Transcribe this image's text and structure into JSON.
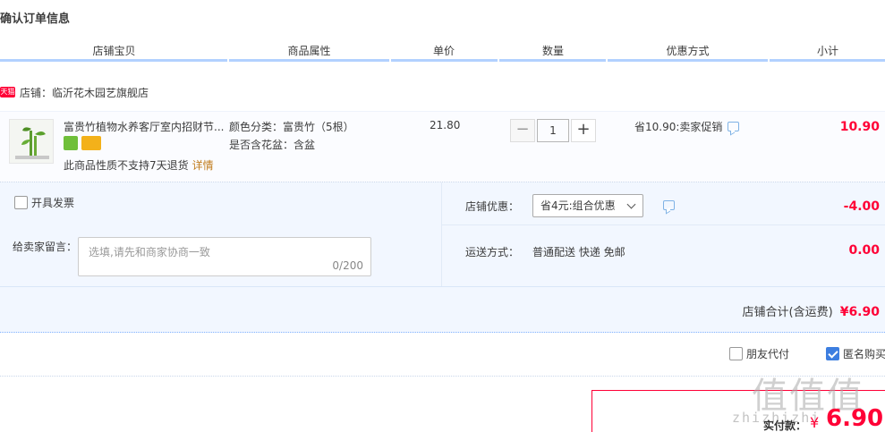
{
  "page": {
    "title": "确认订单信息"
  },
  "columns": [
    "店铺宝贝",
    "商品属性",
    "单价",
    "数量",
    "优惠方式",
    "小计"
  ],
  "shop": {
    "badge": "天猫",
    "label": "店铺：临沂花木园艺旗舰店"
  },
  "item": {
    "title": "富贵竹植物水养客厅室内招财节...",
    "attr_color": "颜色分类：富贵竹（5根）",
    "attr_pot": "是否含花盆：含盆",
    "no_return": "此商品性质不支持7天退货",
    "detail_link": "详情",
    "unit_price": "21.80",
    "qty_minus": "−",
    "qty_plus": "+",
    "quantity": "1",
    "promo": "省10.90:卖家促销",
    "subtotal": "10.90"
  },
  "invoice": {
    "label": "开具发票"
  },
  "message": {
    "label": "给卖家留言：",
    "placeholder": "选填,请先和商家协商一致",
    "counter": "0/200"
  },
  "discount": {
    "label": "店铺优惠：",
    "selected": "省4元:组合优惠",
    "value": "-4.00"
  },
  "shipping": {
    "label": "运送方式：",
    "value": "普通配送 快递 免邮",
    "cost": "0.00"
  },
  "shop_total": {
    "label": "店铺合计(含运费)",
    "amount": "¥6.90"
  },
  "options": {
    "friend_pay": "朋友代付",
    "anonymous": "匿名购买"
  },
  "payment": {
    "label": "实付款：",
    "currency": "¥",
    "amount": "6.90"
  },
  "watermark": {
    "text": "值值值",
    "domain": "zhizhizhi"
  },
  "colors": {
    "accent": "#ff0036",
    "header_line": "#b2d1ff",
    "panel_bg": "#f2f7ff",
    "checkbox": "#3d7ee0"
  }
}
